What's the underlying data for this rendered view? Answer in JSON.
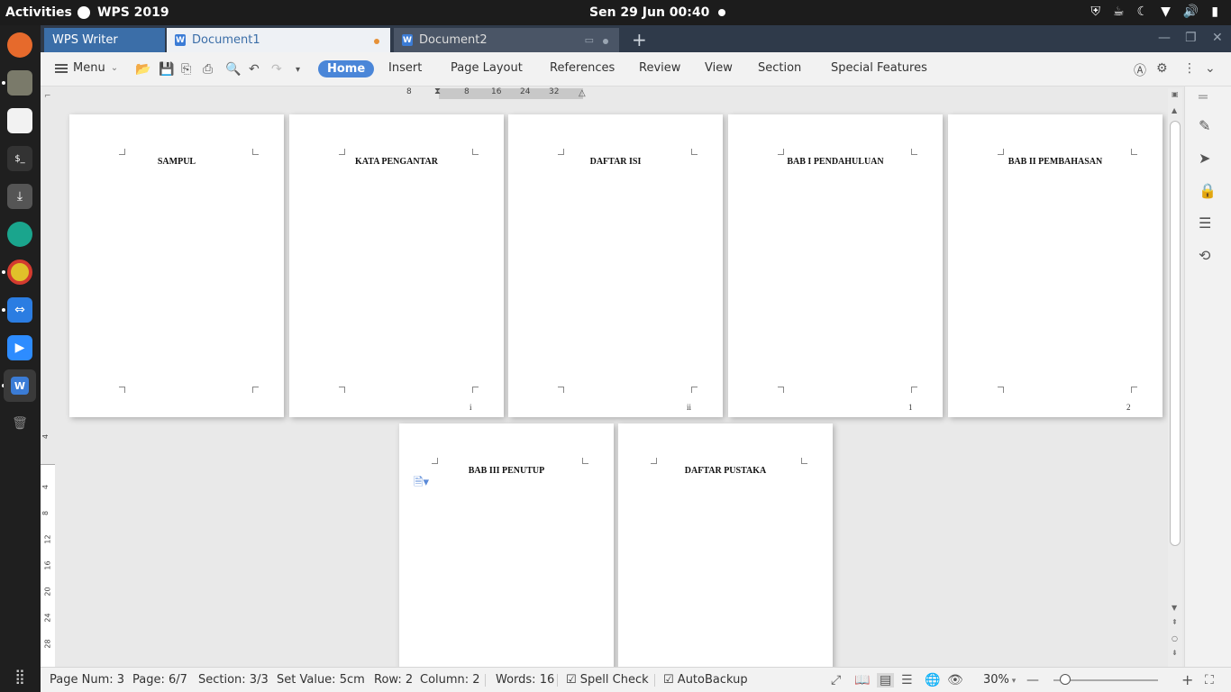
{
  "topbar": {
    "activities": "Activities",
    "app_name": "WPS 2019",
    "clock": "Sen 29 Jun  00:40"
  },
  "tabs": {
    "app": "WPS Writer",
    "doc1": "Document1",
    "doc2": "Document2",
    "add": "+"
  },
  "menubar": {
    "menu": "Menu",
    "ribbon_tabs": [
      "Home",
      "Insert",
      "Page Layout",
      "References",
      "Review",
      "View",
      "Section",
      "Special Features"
    ]
  },
  "ruler": {
    "h_ticks": [
      "8",
      "8",
      "16",
      "24",
      "32"
    ],
    "v_ticks": [
      "4",
      "4",
      "8",
      "12",
      "16",
      "20",
      "24",
      "28"
    ]
  },
  "pages": [
    {
      "title": "SAMPUL",
      "number": ""
    },
    {
      "title": "KATA PENGANTAR",
      "number": "i"
    },
    {
      "title": "DAFTAR ISI",
      "number": "ii"
    },
    {
      "title": "BAB I PENDAHULUAN",
      "number": "1"
    },
    {
      "title": "BAB II PEMBAHASAN",
      "number": "2"
    },
    {
      "title": "BAB III PENUTUP",
      "number": ""
    },
    {
      "title": "DAFTAR PUSTAKA",
      "number": ""
    }
  ],
  "status": {
    "page_num": "Page Num: 3",
    "page": "Page: 6/7",
    "section": "Section: 3/3",
    "set_value": "Set Value: 5cm",
    "row": "Row: 2",
    "column": "Column: 2",
    "words": "Words: 16",
    "spell_check": "Spell Check",
    "autobackup": "AutoBackup",
    "zoom": "30%"
  },
  "colors": {
    "accent": "#4a86d8",
    "tabbar": "#2f3a4a",
    "dock": "#1f1f1f",
    "modified_dot": "#e69137"
  }
}
